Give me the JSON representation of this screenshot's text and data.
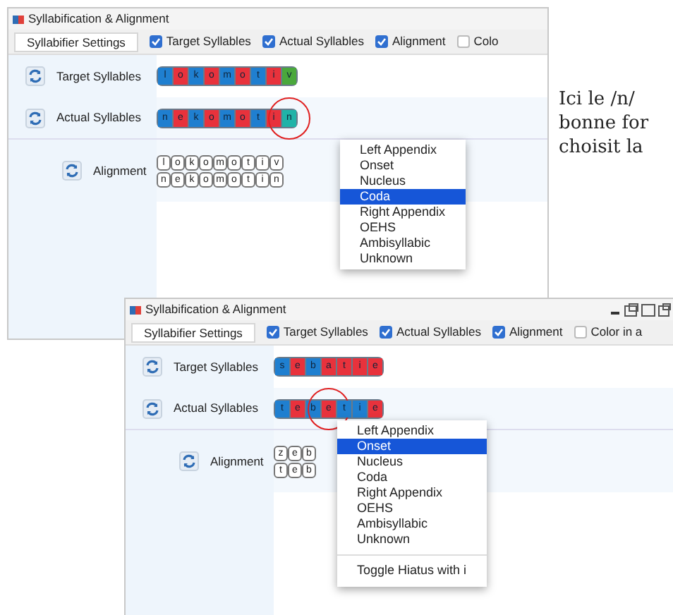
{
  "windows": [
    {
      "title": "Syllabification & Alignment",
      "settings_button": "Syllabifier Settings",
      "window_controls": false,
      "toggles": [
        {
          "label": "Target Syllables",
          "checked": true
        },
        {
          "label": "Actual Syllables",
          "checked": true
        },
        {
          "label": "Alignment",
          "checked": true
        },
        {
          "label": "Colo",
          "checked": false
        }
      ],
      "target": {
        "label": "Target Syllables",
        "phones": [
          {
            "text": "l",
            "color": "#1f7fd0"
          },
          {
            "text": "o",
            "color": "#e8323c"
          },
          {
            "text": "k",
            "color": "#1f7fd0"
          },
          {
            "text": "o",
            "color": "#e8323c"
          },
          {
            "text": "m",
            "color": "#1f7fd0"
          },
          {
            "text": "o",
            "color": "#e8323c"
          },
          {
            "text": "t",
            "color": "#1f7fd0"
          },
          {
            "text": "i",
            "color": "#e8323c"
          },
          {
            "text": "v",
            "color": "#4aa83c"
          }
        ]
      },
      "actual": {
        "label": "Actual Syllables",
        "phones": [
          {
            "text": "n",
            "color": "#1f7fd0",
            "circled": false
          },
          {
            "text": "e",
            "color": "#e8323c",
            "circled": false
          },
          {
            "text": "k",
            "color": "#1f7fd0",
            "circled": false
          },
          {
            "text": "o",
            "color": "#e8323c",
            "circled": false
          },
          {
            "text": "m",
            "color": "#1f7fd0",
            "circled": false
          },
          {
            "text": "o",
            "color": "#e8323c",
            "circled": false
          },
          {
            "text": "t",
            "color": "#1f7fd0",
            "circled": false
          },
          {
            "text": "i",
            "color": "#e8323c",
            "circled": false
          },
          {
            "text": "n",
            "color": "#20b3a8",
            "circled": true
          }
        ]
      },
      "alignment": {
        "label": "Alignment",
        "top": [
          "l",
          "o",
          "k",
          "o",
          "m",
          "o",
          "t",
          "i",
          "v"
        ],
        "bottom": [
          "n",
          "e",
          "k",
          "o",
          "m",
          "o",
          "t",
          "i",
          "n"
        ]
      },
      "menu": {
        "items": [
          {
            "label": "Left Appendix",
            "selected": false
          },
          {
            "label": "Onset",
            "selected": false
          },
          {
            "label": "Nucleus",
            "selected": false
          },
          {
            "label": "Coda",
            "selected": true
          },
          {
            "label": "Right Appendix",
            "selected": false
          },
          {
            "label": "OEHS",
            "selected": false
          },
          {
            "label": "Ambisyllabic",
            "selected": false
          },
          {
            "label": "Unknown",
            "selected": false
          }
        ]
      }
    },
    {
      "title": "Syllabification & Alignment",
      "settings_button": "Syllabifier Settings",
      "window_controls": true,
      "toggles": [
        {
          "label": "Target Syllables",
          "checked": true
        },
        {
          "label": "Actual Syllables",
          "checked": true
        },
        {
          "label": "Alignment",
          "checked": true
        },
        {
          "label": "Color in a",
          "checked": false
        }
      ],
      "target": {
        "label": "Target Syllables",
        "phones": [
          {
            "text": "s",
            "color": "#1f7fd0"
          },
          {
            "text": "e",
            "color": "#e8323c"
          },
          {
            "text": "b",
            "color": "#1f7fd0"
          },
          {
            "text": "a",
            "color": "#e8323c"
          },
          {
            "text": "t",
            "color": "#e8323c"
          },
          {
            "text": "i",
            "color": "#e8323c"
          },
          {
            "text": "e",
            "color": "#e8323c"
          }
        ]
      },
      "actual": {
        "label": "Actual Syllables",
        "phones": [
          {
            "text": "t",
            "color": "#1f7fd0",
            "circled": false
          },
          {
            "text": "e",
            "color": "#e8323c",
            "circled": false
          },
          {
            "text": "b",
            "color": "#1f7fd0",
            "circled": false
          },
          {
            "text": "e",
            "color": "#e8323c",
            "circled": true
          },
          {
            "text": "t",
            "color": "#1f7fd0",
            "circled": false
          },
          {
            "text": "i",
            "color": "#1f7fd0",
            "circled": false
          },
          {
            "text": "e",
            "color": "#e8323c",
            "circled": false
          }
        ]
      },
      "alignment": {
        "label": "Alignment",
        "top": [
          "z",
          "e",
          "b"
        ],
        "bottom": [
          "t",
          "e",
          "b"
        ]
      },
      "menu": {
        "items": [
          {
            "label": "Left Appendix",
            "selected": false
          },
          {
            "label": "Onset",
            "selected": true
          },
          {
            "label": "Nucleus",
            "selected": false
          },
          {
            "label": "Coda",
            "selected": false
          },
          {
            "label": "Right Appendix",
            "selected": false
          },
          {
            "label": "OEHS",
            "selected": false
          },
          {
            "label": "Ambisyllabic",
            "selected": false
          },
          {
            "label": "Unknown",
            "selected": false
          }
        ],
        "extra": "Toggle Hiatus with i"
      }
    }
  ],
  "note_lines": [
    "Ici le /n/",
    "bonne for",
    "choisit la"
  ]
}
